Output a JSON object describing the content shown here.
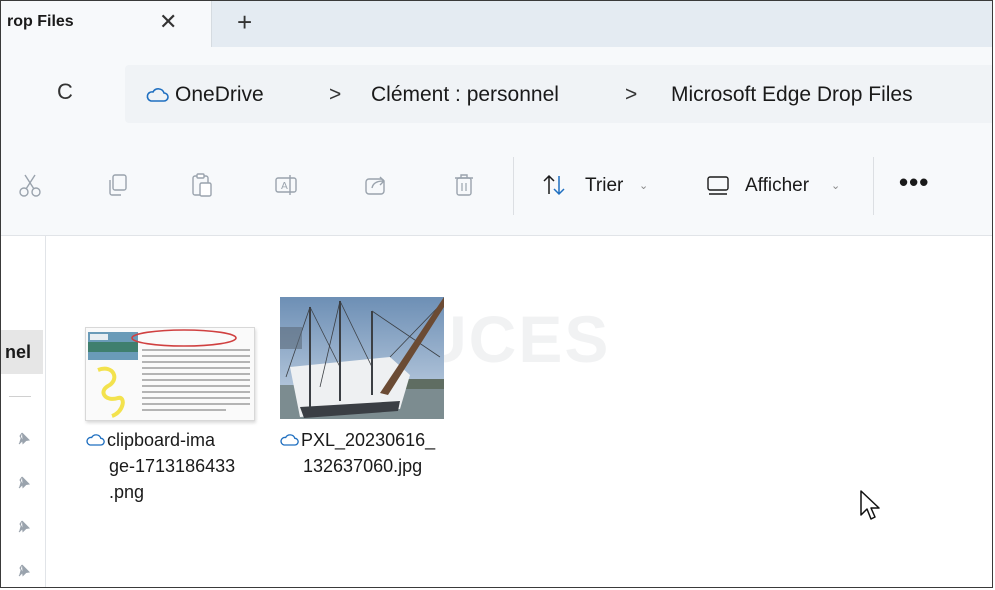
{
  "tab": {
    "title": "rop Files",
    "close_glyph": "✕",
    "new_tab_glyph": "+"
  },
  "address": {
    "refresh_glyph": "C",
    "crumbs": [
      "OneDrive",
      "Clément : personnel",
      "Microsoft Edge Drop Files"
    ],
    "separator": ">"
  },
  "toolbar": {
    "icons": [
      "cut-icon",
      "copy-icon",
      "paste-icon",
      "rename-icon",
      "share-icon",
      "delete-icon"
    ],
    "sort_label": "Trier",
    "view_label": "Afficher",
    "chevron": "⌄",
    "more_label": "•••"
  },
  "nav": {
    "selected_label": "nel",
    "pins": 4
  },
  "files": [
    {
      "lines": [
        "clipboard-ima",
        "ge-1713186433",
        ".png"
      ],
      "icon": "cloud-icon"
    },
    {
      "lines": [
        "PXL_20230616_",
        "132637060.jpg"
      ],
      "icon": "cloud-icon"
    }
  ],
  "watermark": "ASTUCES"
}
